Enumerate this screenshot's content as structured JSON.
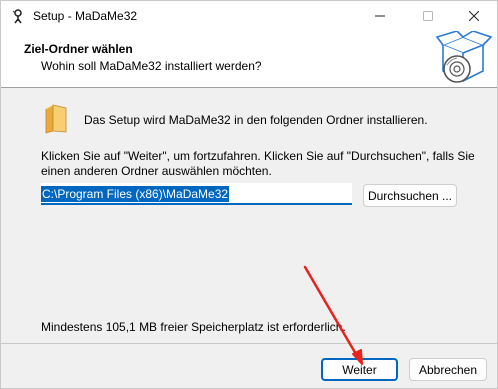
{
  "window": {
    "title": "Setup - MaDaMe32",
    "controls": {
      "minimize_icon": "minimize-icon",
      "maximize_icon": "maximize-icon",
      "close_icon": "close-icon"
    }
  },
  "header": {
    "title": "Ziel-Ordner wählen",
    "subtitle": "Wohin soll MaDaMe32 installiert werden?"
  },
  "body": {
    "intro": "Das Setup wird MaDaMe32 in den folgenden Ordner installieren.",
    "instructions": "Klicken Sie auf \"Weiter\", um fortzufahren. Klicken Sie auf \"Durchsuchen\", falls Sie einen anderen Ordner auswählen möchten.",
    "path_value": "C:\\Program Files (x86)\\MaDaMe32",
    "browse_label": "Durchsuchen ...",
    "space_note": "Mindestens 105,1 MB freier Speicherplatz ist erforderlich."
  },
  "footer": {
    "next_label": "Weiter",
    "cancel_label": "Abbrechen"
  },
  "colors": {
    "accent": "#0067c0",
    "annotation_arrow": "#e8231e",
    "folder": "#f2c15f"
  }
}
